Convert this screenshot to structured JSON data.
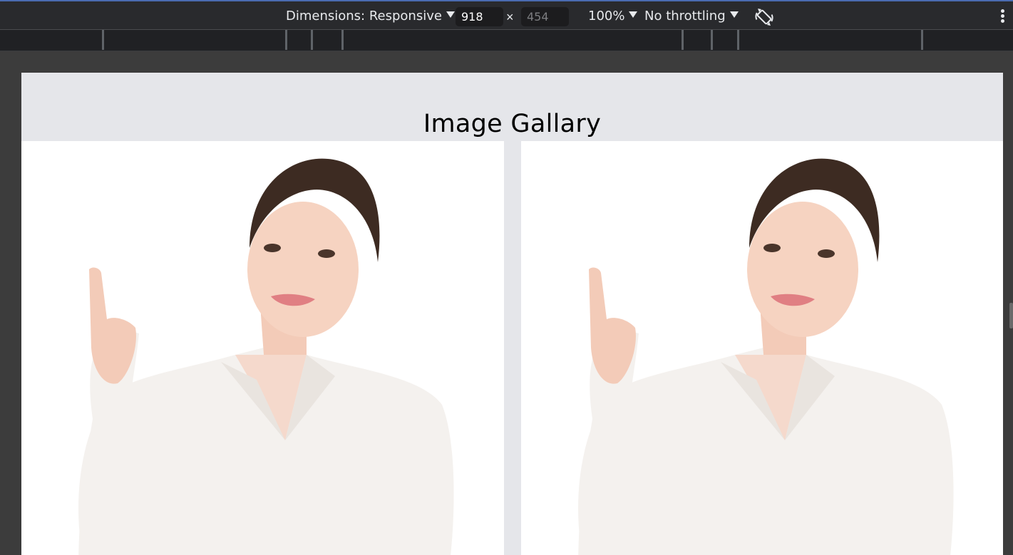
{
  "toolbar": {
    "dimensions_label": "Dimensions: Responsive",
    "width_value": "918",
    "height_placeholder": "454",
    "times_symbol": "×",
    "zoom_label": "100%",
    "throttling_label": "No throttling",
    "rotate_icon": "rotate-icon",
    "more_icon": "kebab-menu-icon"
  },
  "page": {
    "title": "Image Gallary"
  },
  "gallery": {
    "images": [
      {
        "subject": "woman-pointing-up"
      },
      {
        "subject": "woman-pointing-up"
      }
    ]
  }
}
